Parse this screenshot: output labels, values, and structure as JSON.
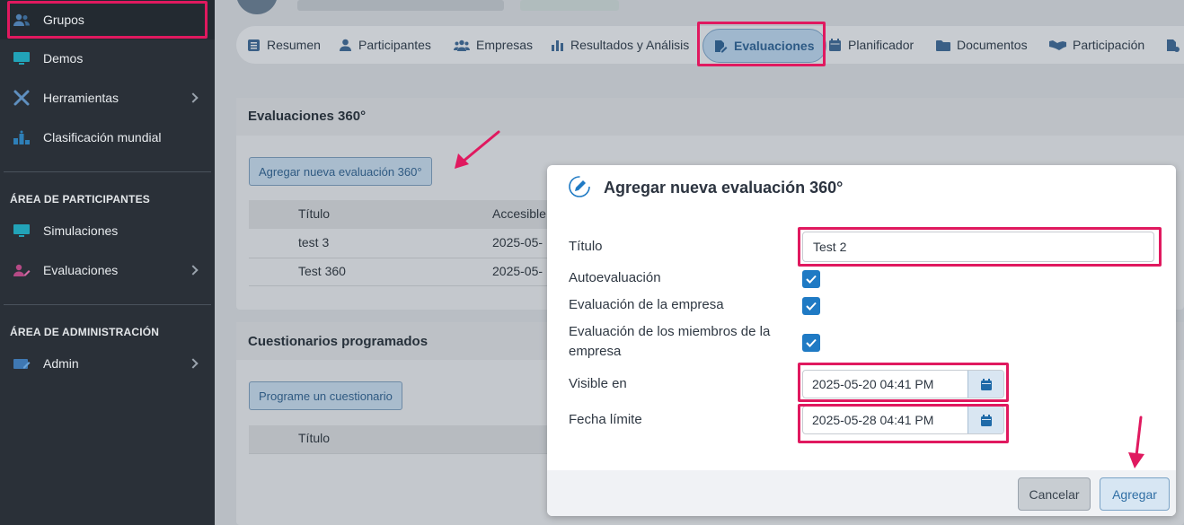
{
  "sidebar": {
    "items": [
      {
        "label": "Grupos",
        "icon": "users-icon"
      },
      {
        "label": "Demos",
        "icon": "monitor-icon"
      },
      {
        "label": "Herramientas",
        "icon": "tools-icon"
      },
      {
        "label": "Clasificación mundial",
        "icon": "podium-icon"
      }
    ],
    "participants_section": "ÁREA DE PARTICIPANTES",
    "participants_items": [
      {
        "label": "Simulaciones",
        "icon": "monitor-icon"
      },
      {
        "label": "Evaluaciones",
        "icon": "user-edit-icon"
      }
    ],
    "admin_section": "ÁREA DE ADMINISTRACIÓN",
    "admin_items": [
      {
        "label": "Admin",
        "icon": "admin-icon"
      }
    ]
  },
  "tabs": [
    {
      "label": "Resumen",
      "icon": "list-icon"
    },
    {
      "label": "Participantes",
      "icon": "user-icon"
    },
    {
      "label": "Empresas",
      "icon": "users-icon"
    },
    {
      "label": "Resultados y Análisis",
      "icon": "bar-chart-icon"
    },
    {
      "label": "Evaluaciones",
      "icon": "file-edit-icon"
    },
    {
      "label": "Planificador",
      "icon": "calendar-icon"
    },
    {
      "label": "Documentos",
      "icon": "folder-icon"
    },
    {
      "label": "Participación",
      "icon": "handshake-icon"
    }
  ],
  "evaluations_panel": {
    "title": "Evaluaciones 360°",
    "add_button": "Agregar nueva evaluación 360°",
    "columns": [
      "Título",
      "Accesible"
    ],
    "rows": [
      {
        "title": "test 3",
        "date": "2025-05-"
      },
      {
        "title": "Test 360",
        "date": "2025-05-"
      }
    ]
  },
  "questionnaires_panel": {
    "title": "Cuestionarios programados",
    "schedule_button": "Programe un cuestionario",
    "columns": [
      "Título"
    ]
  },
  "modal": {
    "title": "Agregar nueva evaluación 360°",
    "title_label": "Título",
    "title_value": "Test 2",
    "self_eval_label": "Autoevaluación",
    "company_eval_label": "Evaluación de la empresa",
    "members_eval_label_1": "Evaluación de los miembros de la",
    "members_eval_label_2": "empresa",
    "visible_label": "Visible en",
    "visible_value": "2025-05-20 04:41 PM",
    "deadline_label": "Fecha límite",
    "deadline_value": "2025-05-28 04:41 PM",
    "cancel_button": "Cancelar",
    "add_button": "Agregar",
    "checkboxes": {
      "self": true,
      "company": true,
      "members": true
    }
  },
  "colors": {
    "highlight": "#e0195f",
    "primary": "#1f7ac4",
    "sidebar_bg": "#2a3038"
  }
}
